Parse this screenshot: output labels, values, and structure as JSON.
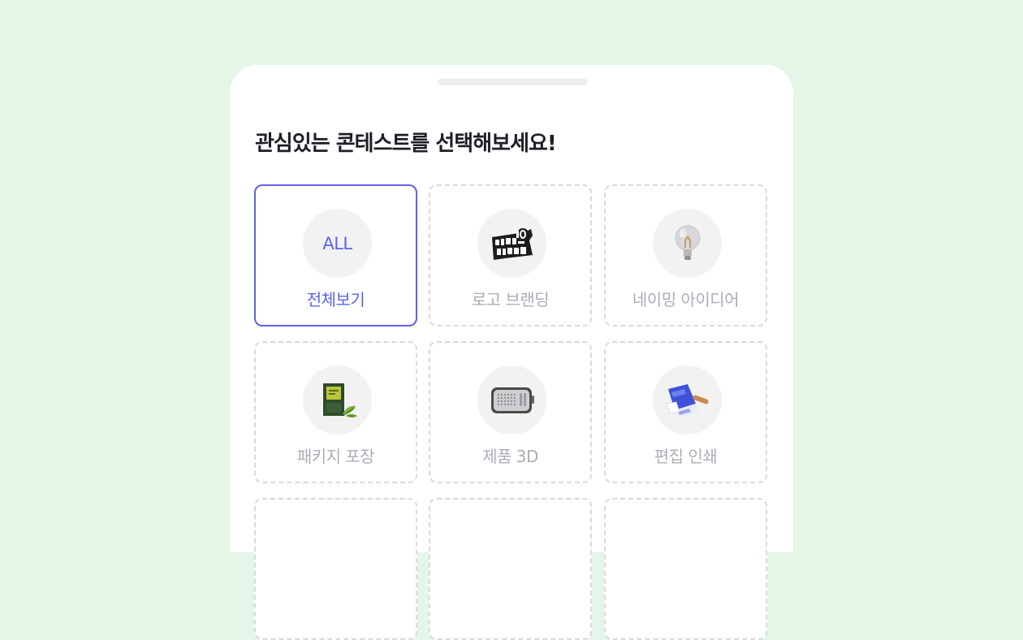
{
  "title": "관심있는 콘테스트를 선택해보세요!",
  "accent_color": "#5b63ea",
  "categories": [
    {
      "label": "전체보기",
      "icon_text": "ALL",
      "selected": true
    },
    {
      "label": "로고 브랜딩",
      "icon": "logo-badge-icon",
      "selected": false
    },
    {
      "label": "네이밍 아이디어",
      "icon": "lightbulb-icon",
      "selected": false
    },
    {
      "label": "패키지 포장",
      "icon": "package-box-icon",
      "selected": false
    },
    {
      "label": "제품 3D",
      "icon": "radio-product-icon",
      "selected": false
    },
    {
      "label": "편집 인쇄",
      "icon": "printed-brochure-icon",
      "selected": false
    }
  ]
}
